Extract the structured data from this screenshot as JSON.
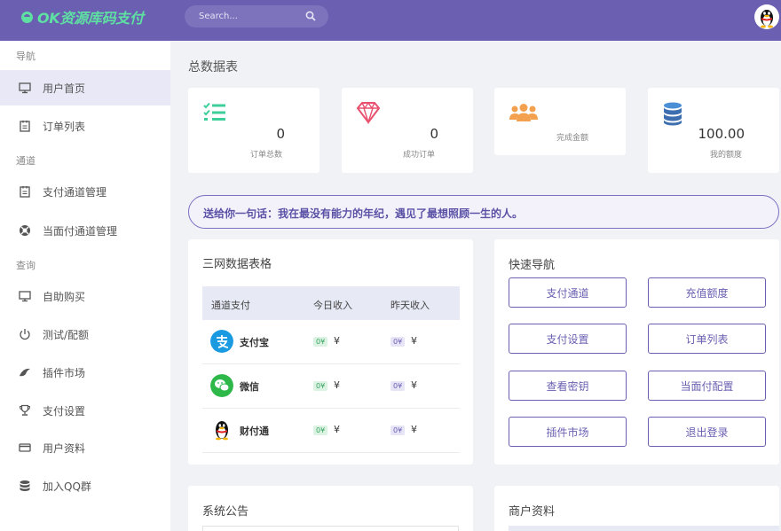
{
  "header": {
    "logo_text": "OK资源库码支付",
    "search_placeholder": "Search...",
    "brand_color": "#6a5fb1",
    "logo_color": "#5fe0a3"
  },
  "sidebar": {
    "sections": [
      "导航",
      "通道",
      "查询"
    ],
    "items": [
      {
        "label": "用户首页",
        "icon": "monitor-icon",
        "active": true
      },
      {
        "label": "订单列表",
        "icon": "clipboard-icon"
      },
      {
        "label": "支付通道管理",
        "icon": "clipboard-icon"
      },
      {
        "label": "当面付通道管理",
        "icon": "lifebuoy-icon"
      },
      {
        "label": "自助购买",
        "icon": "monitor-icon"
      },
      {
        "label": "测试/配额",
        "icon": "power-icon"
      },
      {
        "label": "插件市场",
        "icon": "leaf-icon"
      },
      {
        "label": "支付设置",
        "icon": "trophy-icon"
      },
      {
        "label": "用户资料",
        "icon": "card-icon"
      },
      {
        "label": "加入QQ群",
        "icon": "database-icon"
      }
    ]
  },
  "main": {
    "page_title": "总数据表",
    "stats": [
      {
        "value": "0",
        "label": "订单总数",
        "icon": "checklist-icon",
        "color": "#3ccf9a"
      },
      {
        "value": "0",
        "label": "成功订单",
        "icon": "diamond-icon",
        "color": "#e8506e"
      },
      {
        "value": "",
        "label": "完成金额",
        "icon": "users-icon",
        "color": "#f4a14f"
      },
      {
        "value": "100.00",
        "label": "我的额度",
        "icon": "database-icon",
        "color": "#4a8fd6"
      }
    ],
    "banner": "送给你一句话：我在最没有能力的年纪，遇见了最想照顾一生的人。",
    "table_panel": {
      "title": "三网数据表格",
      "headers": [
        "通道支付",
        "今日收入",
        "昨天收入"
      ],
      "rows": [
        {
          "name": "支付宝",
          "icon": "alipay-icon",
          "today": "0¥",
          "yesterday": "0¥",
          "unit": "¥"
        },
        {
          "name": "微信",
          "icon": "wechat-icon",
          "today": "0¥",
          "yesterday": "0¥",
          "unit": "¥"
        },
        {
          "name": "财付通",
          "icon": "qq-penguin-icon",
          "today": "0¥",
          "yesterday": "0¥",
          "unit": "¥"
        }
      ]
    },
    "quick_nav": {
      "title": "快速导航",
      "buttons": [
        "支付通道",
        "充值额度",
        "支付设置",
        "订单列表",
        "查看密钥",
        "当面付配置",
        "插件市场",
        "退出登录"
      ]
    },
    "notice_title": "系统公告",
    "merchant_title": "商户资料"
  }
}
